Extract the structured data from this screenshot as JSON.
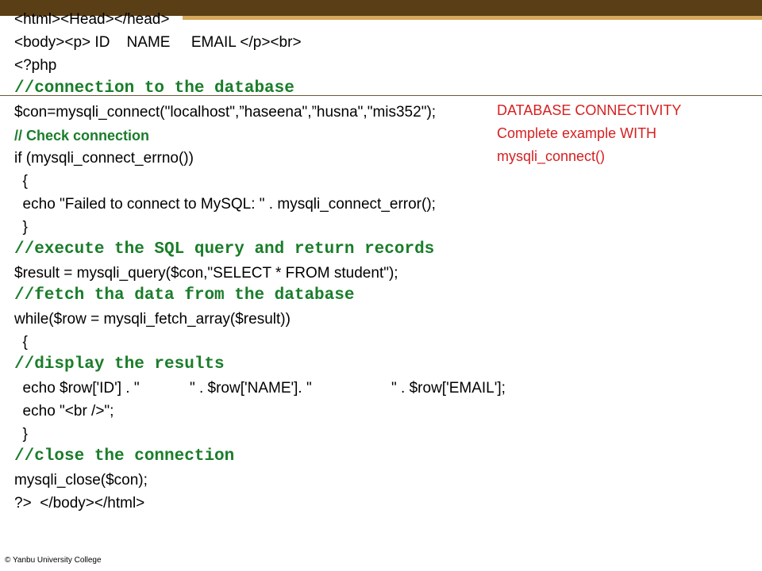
{
  "slide": {
    "code_lines": [
      "<html><Head></head>",
      "<body><p> ID    NAME     EMAIL </p><br>",
      "<?php",
      "//connection to the database",
      "$con=mysqli_connect(\"localhost\",”haseena\",”husna\",\"mis352\");",
      "// Check connection",
      "if (mysqli_connect_errno())",
      "  {",
      "  echo \"Failed to connect to MySQL: \" . mysqli_connect_error();",
      "  }",
      "//execute the SQL query and return records",
      "$result = mysqli_query($con,\"SELECT * FROM student\");",
      "//fetch tha data from the database",
      "while($row = mysqli_fetch_array($result))",
      "  {",
      "//display the results",
      "  echo $row['ID'] . \"            \" . $row['NAME']. \"                   \" . $row['EMAIL'];",
      "  echo \"<br />\";",
      "  }",
      "//close the connection",
      "mysqli_close($con);",
      "?>  </body></html>"
    ],
    "note_lines": [
      "DATABASE CONNECTIVITY",
      "Complete example WITH",
      "mysqli_connect()"
    ],
    "footer": "© Yanbu University College"
  },
  "colors": {
    "top_bar": "#5a3e15",
    "accent": "#d6a85c",
    "comment_green": "#1a7d2a",
    "note_red": "#d62020"
  }
}
